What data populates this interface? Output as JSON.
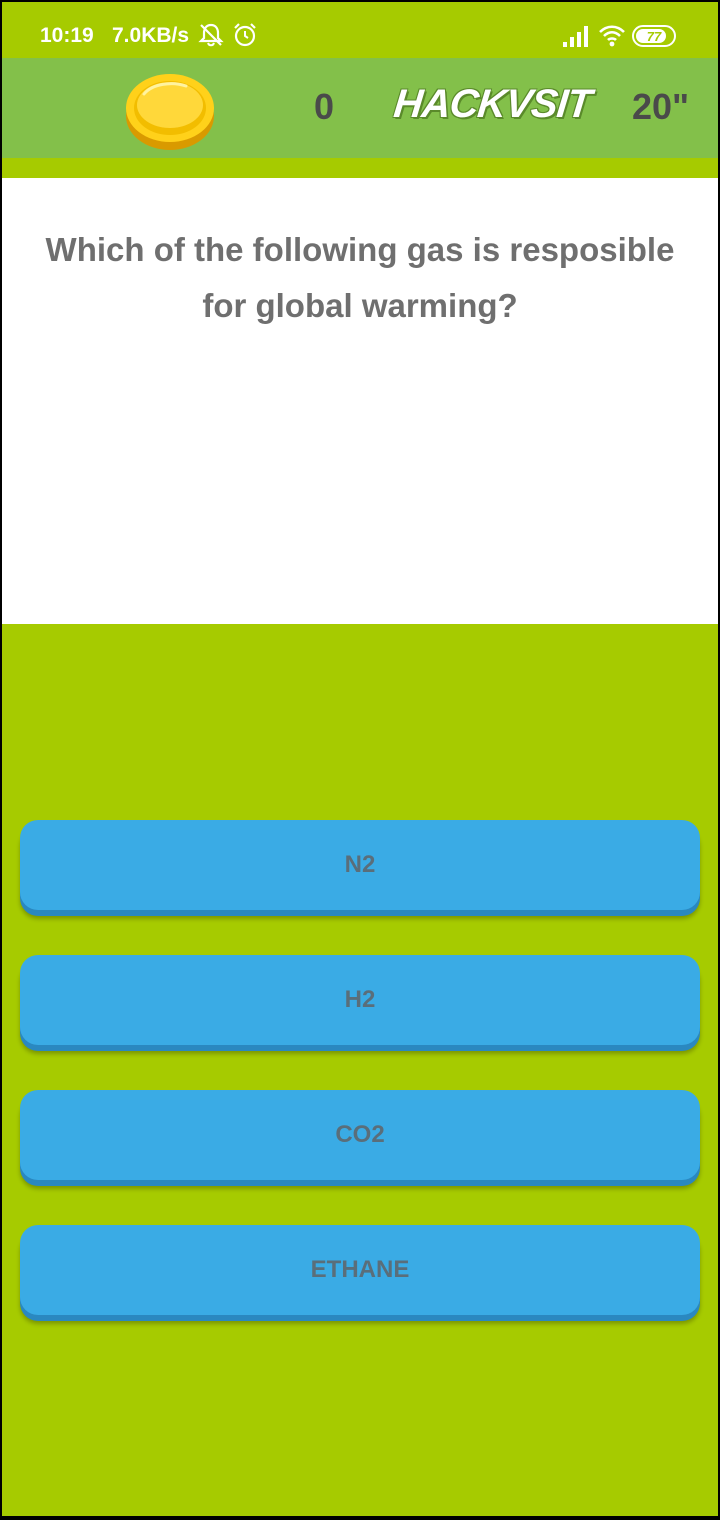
{
  "status_bar": {
    "time": "10:19",
    "network_speed": "7.0KB/s",
    "battery_level": "77",
    "icons": [
      "silent-mode-icon",
      "alarm-clock-icon",
      "signal-strength-icon",
      "wifi-icon",
      "battery-icon"
    ]
  },
  "header": {
    "coin_icon": "gold-coin-icon",
    "score": "0",
    "logo_text": "HACKVSIT",
    "timer": "20\""
  },
  "question": {
    "text": "Which of the following gas is resposible for global warming?"
  },
  "answers": [
    {
      "label": "N2"
    },
    {
      "label": "H2"
    },
    {
      "label": "CO2"
    },
    {
      "label": "ETHANE"
    }
  ],
  "colors": {
    "background": "#a6cb00",
    "header": "#83c04a",
    "question_panel": "#ffffff",
    "answer_button": "#3aabe5",
    "answer_shadow": "#2a88c0",
    "text_dark": "#4a4a4a",
    "question_text": "#6f6f6f"
  }
}
